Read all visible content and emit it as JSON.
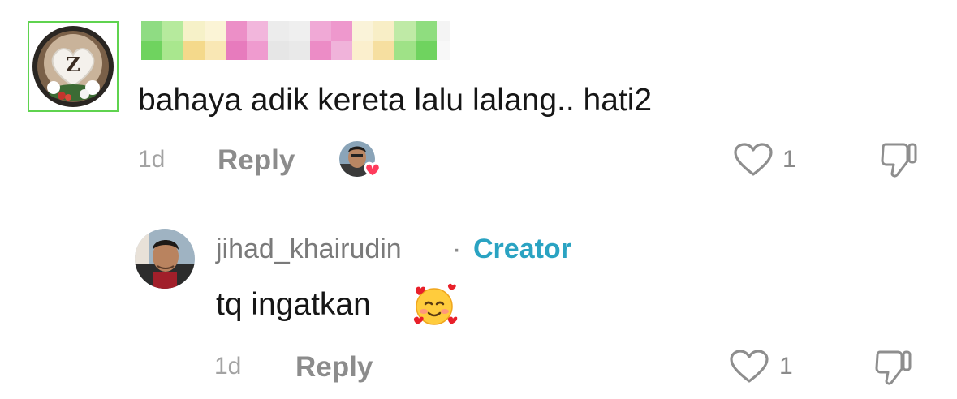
{
  "comment": {
    "text": "bahaya adik kereta lalu lalang.. hati2",
    "time": "1d",
    "reply_label": "Reply",
    "likes": "1",
    "avatar_letter": "Z",
    "creator_liked": true,
    "colors": {
      "avatar_border": "#5fd34f",
      "heart": "#ff3b5c"
    }
  },
  "reply": {
    "username": "jihad_khairudin",
    "separator": "·",
    "badge": "Creator",
    "text": "tq ingatkan",
    "emoji": "smiling-face-with-hearts",
    "time": "1d",
    "reply_label": "Reply",
    "likes": "1",
    "colors": {
      "badge": "#2aa3c2"
    }
  }
}
